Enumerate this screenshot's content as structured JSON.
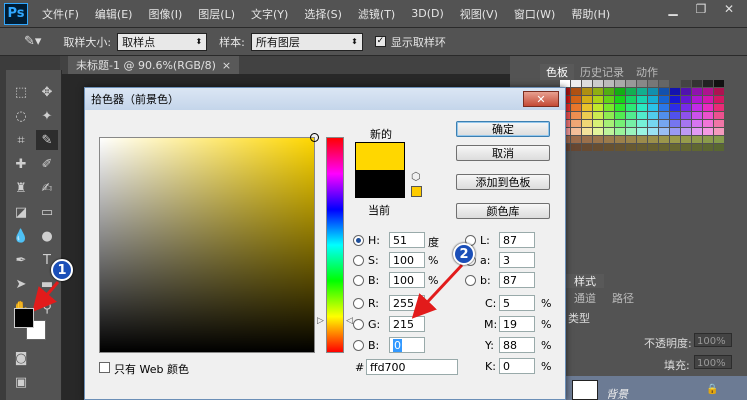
{
  "app": {
    "logo": "Ps"
  },
  "menu": [
    "文件(F)",
    "编辑(E)",
    "图像(I)",
    "图层(L)",
    "文字(Y)",
    "选择(S)",
    "滤镜(T)",
    "3D(D)",
    "视图(V)",
    "窗口(W)",
    "帮助(H)"
  ],
  "options": {
    "sample_size_label": "取样大小:",
    "sample_size_value": "取样点",
    "sample_label": "样本:",
    "sample_value": "所有图层",
    "show_ring_label": "显示取样环",
    "show_ring_checked": true
  },
  "document": {
    "tab_title": "未标题-1 @ 90.6%(RGB/8)"
  },
  "right_panel": {
    "swatch_tabs": [
      "色板",
      "历史记录",
      "动作"
    ],
    "styles_tab": "样式",
    "layer_tabs": [
      "通道",
      "路径"
    ],
    "kind_label": "类型",
    "opacity_label": "不透明度:",
    "opacity_value": "100%",
    "fill_label": "填充:",
    "fill_value": "100%",
    "layer_name": "背景"
  },
  "dialog": {
    "title": "拾色器（前景色）",
    "new_label": "新的",
    "current_label": "当前",
    "new_color": "#ffd700",
    "current_color": "#000000",
    "buttons": {
      "ok": "确定",
      "cancel": "取消",
      "add_swatch": "添加到色板",
      "library": "颜色库"
    },
    "hsb": {
      "h_label": "H:",
      "h_value": "51",
      "h_unit": "度",
      "s_label": "S:",
      "s_value": "100",
      "s_unit": "%",
      "b_label": "B:",
      "b_value": "100",
      "b_unit": "%"
    },
    "rgb": {
      "r_label": "R:",
      "r_value": "255",
      "g_label": "G:",
      "g_value": "215",
      "b_label": "B:",
      "b_value": "0"
    },
    "lab": {
      "l_label": "L:",
      "l_value": "87",
      "a_label": "a:",
      "a_value": "3",
      "b_label": "b:",
      "b_value": "87"
    },
    "cmyk": {
      "c_label": "C:",
      "c_value": "5",
      "m_label": "M:",
      "m_value": "19",
      "y_label": "Y:",
      "y_value": "88",
      "k_label": "K:",
      "k_value": "0",
      "unit": "%"
    },
    "web_only_label": "只有 Web 颜色",
    "hex_label": "#",
    "hex_value": "ffd700"
  },
  "annotations": {
    "badge_1": "1",
    "badge_2": "2"
  },
  "colors": {
    "accent": "#1b4fb8",
    "arrow": "#e21b1b",
    "foreground": "#000000",
    "background": "#ffffff"
  }
}
